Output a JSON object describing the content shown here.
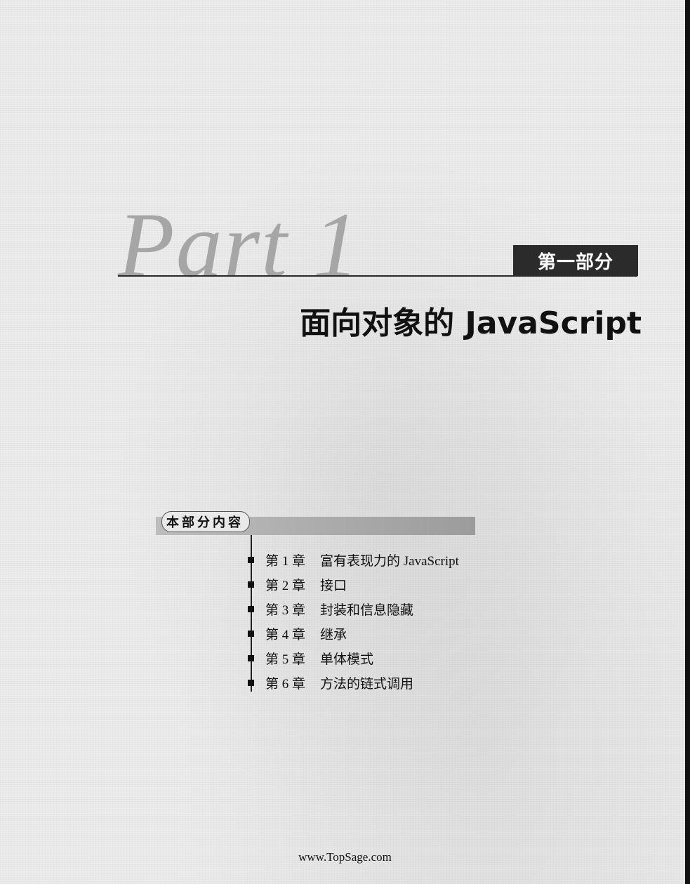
{
  "part": {
    "word": "Part 1",
    "badge": "第一部分",
    "title": "面向对象的 JavaScript"
  },
  "toc": {
    "heading": "本部分内容",
    "items": [
      {
        "chapter": "第 1 章",
        "name": "富有表现力的 JavaScript"
      },
      {
        "chapter": "第 2 章",
        "name": "接口"
      },
      {
        "chapter": "第 3 章",
        "name": "封装和信息隐藏"
      },
      {
        "chapter": "第 4 章",
        "name": "继承"
      },
      {
        "chapter": "第 5 章",
        "name": "单体模式"
      },
      {
        "chapter": "第 6 章",
        "name": "方法的链式调用"
      }
    ]
  },
  "footer": {
    "url": "www.TopSage.com"
  },
  "colors": {
    "badge_bg": "#2b2b2b",
    "part_word": "#a6a6a6"
  }
}
